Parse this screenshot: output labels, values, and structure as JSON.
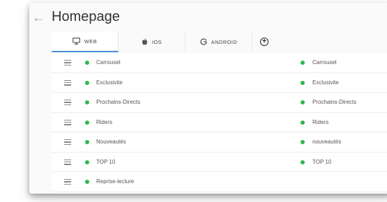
{
  "page": {
    "title": "Homepage"
  },
  "tabs": [
    {
      "label": "WEB",
      "icon": "monitor-icon"
    },
    {
      "label": "IOS",
      "icon": "apple-icon"
    },
    {
      "label": "ANDROID",
      "icon": "google-icon"
    }
  ],
  "colors": {
    "accent": "#4a8fd9",
    "status_active": "#2db84d"
  },
  "rows": [
    {
      "left": "Carrousel",
      "right": "Carrousel"
    },
    {
      "left": "Exclusivite",
      "right": "Exclusivite"
    },
    {
      "left": "Prochains-Directs",
      "right": "Prochains-Directs"
    },
    {
      "left": "Riders",
      "right": "Riders"
    },
    {
      "left": "Nouveautés",
      "right": "nouveautés"
    },
    {
      "left": "TOP 10",
      "right": "TOP 10"
    },
    {
      "left": "Reprise-lecture",
      "right": ""
    }
  ]
}
